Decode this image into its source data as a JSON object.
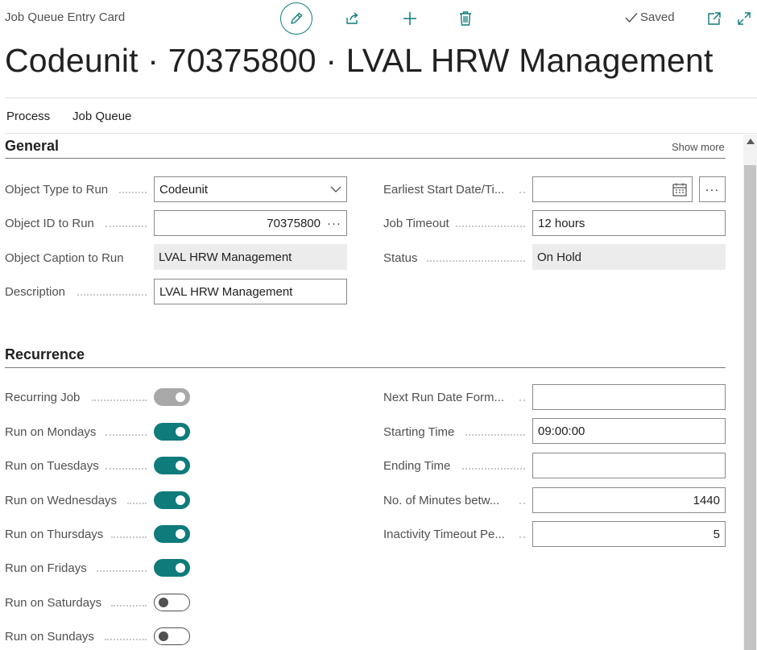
{
  "header": {
    "card_label": "Job Queue Entry Card",
    "saved_label": "Saved",
    "title": "Codeunit · 70375800 · LVAL HRW Management"
  },
  "toolbar_icons": [
    "pencil-icon",
    "share-icon",
    "plus-icon",
    "trash-icon",
    "checkmark-icon",
    "open-new-window-icon",
    "expand-icon"
  ],
  "menu": [
    "Process",
    "Job Queue"
  ],
  "general": {
    "title": "General",
    "show_more": "Show more",
    "object_type_label": "Object Type to Run",
    "object_type_value": "Codeunit",
    "object_id_label": "Object ID to Run",
    "object_id_value": "70375800",
    "object_caption_label": "Object Caption to Run",
    "object_caption_value": "LVAL HRW Management",
    "description_label": "Description",
    "description_value": "LVAL HRW Management",
    "earliest_start_label": "Earliest Start Date/Ti...",
    "earliest_start_value": "",
    "job_timeout_label": "Job Timeout",
    "job_timeout_value": "12 hours",
    "status_label": "Status",
    "status_value": "On Hold"
  },
  "recurrence": {
    "title": "Recurrence",
    "toggles": [
      {
        "label": "Recurring Job",
        "state": "on-disabled"
      },
      {
        "label": "Run on Mondays",
        "state": "on"
      },
      {
        "label": "Run on Tuesdays",
        "state": "on"
      },
      {
        "label": "Run on Wednesdays",
        "state": "on"
      },
      {
        "label": "Run on Thursdays",
        "state": "on"
      },
      {
        "label": "Run on Fridays",
        "state": "on"
      },
      {
        "label": "Run on Saturdays",
        "state": "off"
      },
      {
        "label": "Run on Sundays",
        "state": "off"
      }
    ],
    "next_run_label": "Next Run Date Form...",
    "next_run_value": "",
    "starting_time_label": "Starting Time",
    "starting_time_value": "09:00:00",
    "ending_time_label": "Ending Time",
    "ending_time_value": "",
    "minutes_between_label": "No. of Minutes betw...",
    "minutes_between_value": "1440",
    "inactivity_label": "Inactivity Timeout Pe...",
    "inactivity_value": "5"
  },
  "colors": {
    "accent": "#0f7b7b",
    "toggle_off_border": "#505050",
    "readonly_bg": "#ececec"
  }
}
